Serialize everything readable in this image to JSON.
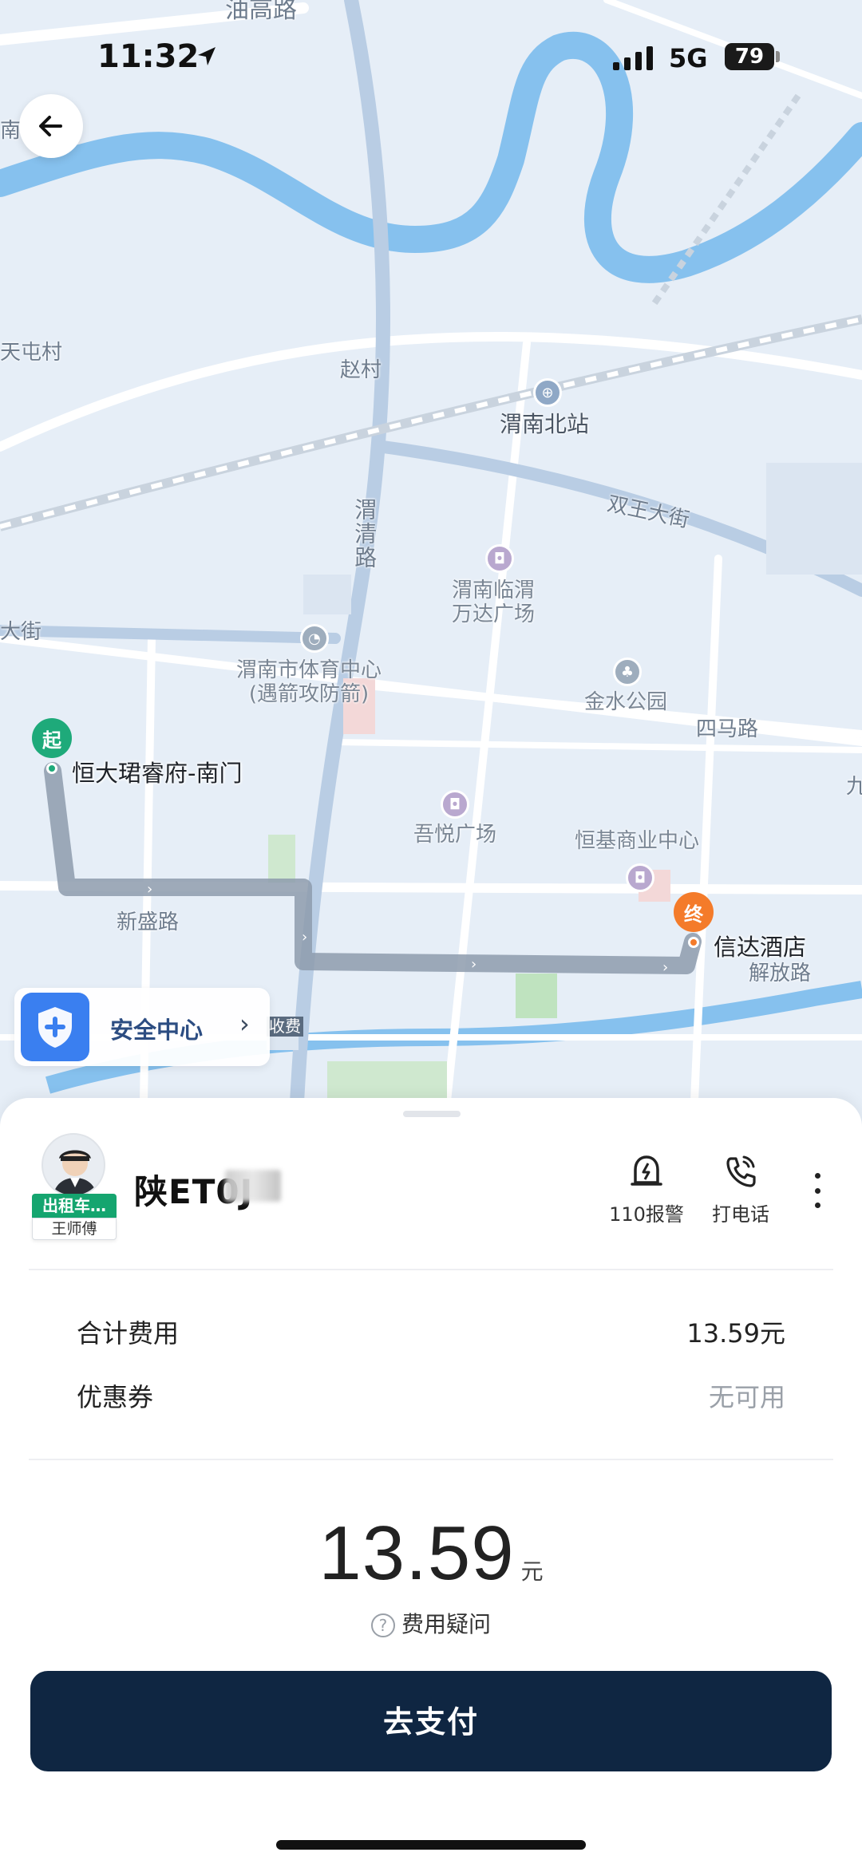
{
  "status_bar": {
    "time": "11:32",
    "network": "5G",
    "battery": "79"
  },
  "map": {
    "labels": {
      "youjin_road": "油高路",
      "zhaocun": "赵村",
      "tianzhuang": "天屯村",
      "weinan_north_station": "渭南北站",
      "shuangwang_street": "双王大街",
      "weiqing_road": "渭清路",
      "wanda_plaza": "渭南临渭\n万达广场",
      "sports_center": "渭南市体育中心\n(遇箭攻防箭)",
      "jinshui_park": "金水公园",
      "sima_road": "四马路",
      "wuyue_plaza": "吾悦广场",
      "hengji_center": "恒基商业中心",
      "xinsheng_road": "新盛路",
      "jiefang_road": "解放路",
      "left_street": "大街",
      "left_nan": "南",
      "right_jiu": "九",
      "toll": "收费"
    },
    "start": {
      "badge": "起",
      "name": "恒大珺睿府-南门"
    },
    "end": {
      "badge": "终",
      "name": "信达酒店"
    }
  },
  "safety_center": {
    "label": "安全中心",
    "chevron": "›"
  },
  "driver": {
    "badge": "出租车…",
    "name": "王师傅",
    "plate": "陕ET0J"
  },
  "actions": {
    "police": "110报警",
    "call": "打电话"
  },
  "fees": {
    "total_label": "合计费用",
    "total_value": "13.59元",
    "coupon_label": "优惠券",
    "coupon_value": "无可用"
  },
  "amount": {
    "value": "13.59",
    "unit": "元"
  },
  "fee_question": {
    "icon": "?",
    "label": "费用疑问"
  },
  "pay_button": "去支付",
  "colors": {
    "primary_dark": "#0f2642",
    "start_green": "#1eaa7a",
    "end_orange": "#f47b2a",
    "river": "#86c1ee"
  }
}
